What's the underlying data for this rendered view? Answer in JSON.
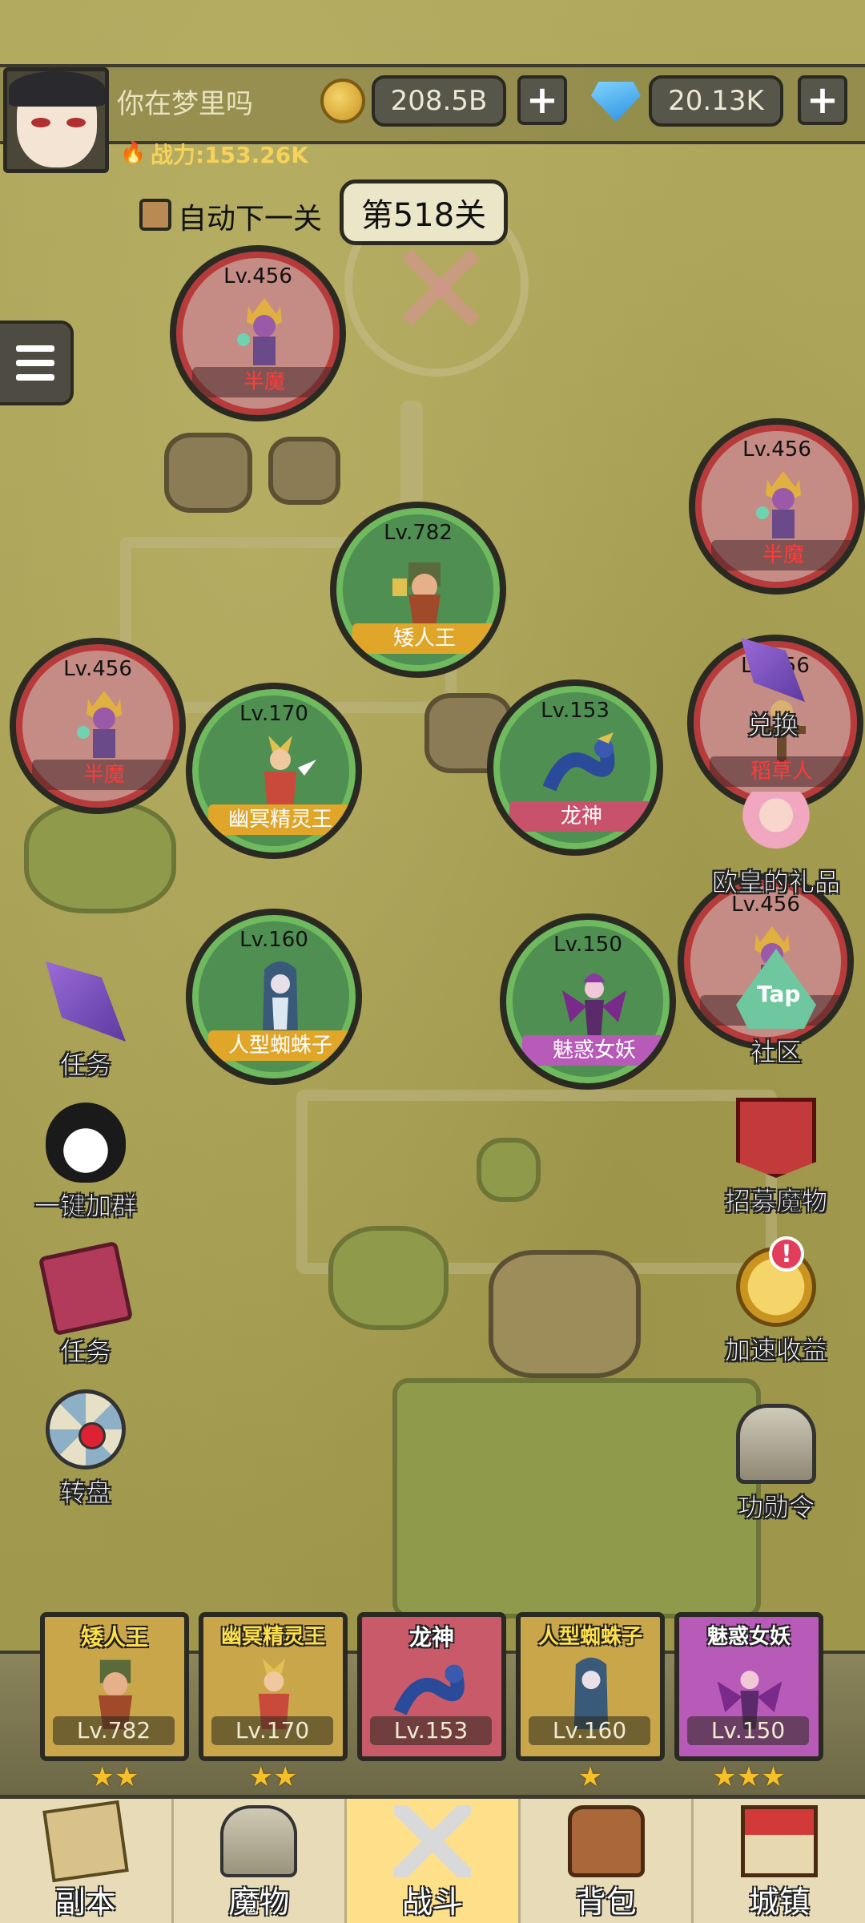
{
  "player": {
    "name": "你在梦里吗",
    "power": "战力:153.26K"
  },
  "currency": {
    "gold": "208.5B",
    "gems": "20.13K",
    "plus": "+"
  },
  "stage": {
    "auto_next_label": "自动下一关",
    "current": "第518关"
  },
  "nodes": [
    {
      "lv": "Lv.456",
      "name": "半魔",
      "type": "enemy"
    },
    {
      "lv": "Lv.456",
      "name": "半魔",
      "type": "enemy"
    },
    {
      "lv": "Lv.782",
      "name": "矮人王",
      "type": "ally"
    },
    {
      "lv": "Lv.456",
      "name": "半魔",
      "type": "enemy"
    },
    {
      "lv": "Lv.170",
      "name": "幽冥精灵王",
      "type": "ally"
    },
    {
      "lv": "Lv.153",
      "name": "龙神",
      "type": "ally"
    },
    {
      "lv": "Lv.456",
      "name": "稻草人",
      "type": "enemy"
    },
    {
      "lv": "Lv.160",
      "name": "人型蜘蛛子",
      "type": "ally"
    },
    {
      "lv": "Lv.150",
      "name": "魅惑女妖",
      "type": "ally"
    },
    {
      "lv": "Lv.456",
      "name": "",
      "type": "enemy"
    }
  ],
  "left_actions": [
    {
      "label": "任务",
      "icon": "firework-rocket-icon"
    },
    {
      "label": "一键加群",
      "icon": "penguin-icon"
    },
    {
      "label": "任务",
      "icon": "book-icon"
    },
    {
      "label": "转盘",
      "icon": "wheel-icon"
    }
  ],
  "right_actions": [
    {
      "label": "兑换",
      "icon": "firework-rocket-icon"
    },
    {
      "label": "欧皇的礼品",
      "icon": "gift-girl-icon"
    },
    {
      "label": "社区",
      "icon": "taptap-icon"
    },
    {
      "label": "招募魔物",
      "icon": "banner-icon"
    },
    {
      "label": "加速收益",
      "icon": "coin-boost-icon",
      "alert": "!"
    },
    {
      "label": "功勋令",
      "icon": "helmet-icon"
    }
  ],
  "team": [
    {
      "name": "矮人王",
      "lv": "Lv.782",
      "stars": "★★"
    },
    {
      "name": "幽冥精灵王",
      "lv": "Lv.170",
      "stars": "★★"
    },
    {
      "name": "龙神",
      "lv": "Lv.153",
      "stars": ""
    },
    {
      "name": "人型蜘蛛子",
      "lv": "Lv.160",
      "stars": "★"
    },
    {
      "name": "魅惑女妖",
      "lv": "Lv.150",
      "stars": "★★★"
    }
  ],
  "bottom_nav": [
    {
      "label": "副本",
      "icon": "scroll-map-icon"
    },
    {
      "label": "魔物",
      "icon": "monster-helmet-icon"
    },
    {
      "label": "战斗",
      "icon": "crossed-swords-icon",
      "active": true
    },
    {
      "label": "背包",
      "icon": "backpack-icon"
    },
    {
      "label": "城镇",
      "icon": "town-shop-icon"
    }
  ]
}
